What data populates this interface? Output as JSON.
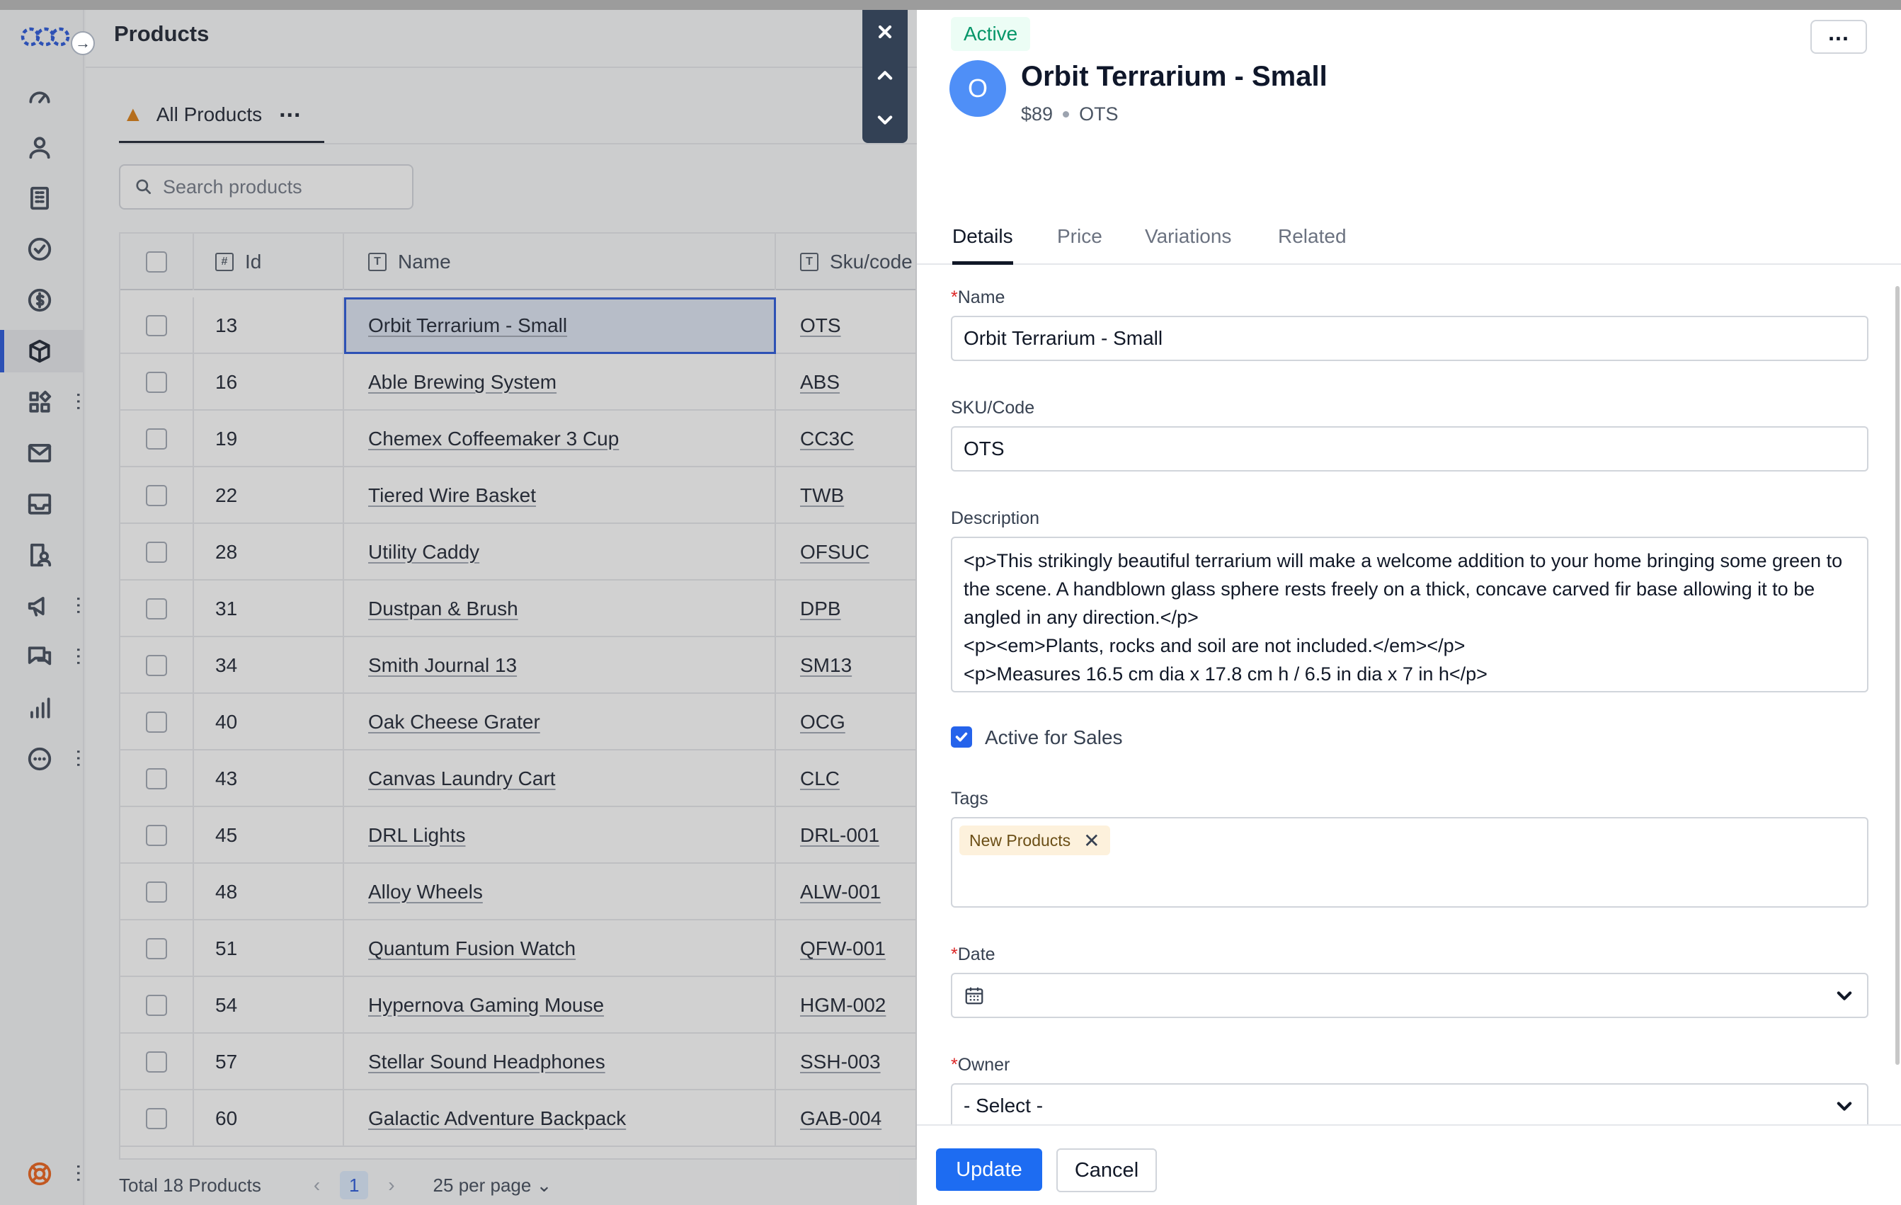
{
  "page": {
    "title": "Products"
  },
  "sidebar": {
    "items": [
      {
        "icon": "dashboard-icon"
      },
      {
        "icon": "contacts-icon"
      },
      {
        "icon": "companies-icon"
      },
      {
        "icon": "tasks-icon"
      },
      {
        "icon": "deals-icon"
      },
      {
        "icon": "products-icon",
        "active": true
      },
      {
        "icon": "apps-icon"
      },
      {
        "icon": "mail-icon"
      },
      {
        "icon": "inbox-icon"
      },
      {
        "icon": "documents-icon"
      },
      {
        "icon": "campaigns-icon"
      },
      {
        "icon": "chat-icon"
      },
      {
        "icon": "reports-icon"
      },
      {
        "icon": "more-icon"
      }
    ],
    "help_icon": "lifebuoy-icon"
  },
  "list": {
    "view_tab": "All Products",
    "search_placeholder": "Search products",
    "columns": {
      "id": "Id",
      "name": "Name",
      "sku": "Sku/code"
    },
    "rows": [
      {
        "id": "13",
        "name": "Orbit Terrarium - Small",
        "sku": "OTS"
      },
      {
        "id": "16",
        "name": "Able Brewing System",
        "sku": "ABS"
      },
      {
        "id": "19",
        "name": "Chemex Coffeemaker 3 Cup",
        "sku": "CC3C"
      },
      {
        "id": "22",
        "name": "Tiered Wire Basket",
        "sku": "TWB"
      },
      {
        "id": "28",
        "name": "Utility Caddy",
        "sku": "OFSUC"
      },
      {
        "id": "31",
        "name": "Dustpan & Brush",
        "sku": "DPB"
      },
      {
        "id": "34",
        "name": "Smith Journal 13",
        "sku": "SM13"
      },
      {
        "id": "40",
        "name": "Oak Cheese Grater",
        "sku": "OCG"
      },
      {
        "id": "43",
        "name": "Canvas Laundry Cart",
        "sku": "CLC"
      },
      {
        "id": "45",
        "name": "DRL Lights",
        "sku": "DRL-001"
      },
      {
        "id": "48",
        "name": "Alloy Wheels",
        "sku": "ALW-001"
      },
      {
        "id": "51",
        "name": "Quantum Fusion Watch",
        "sku": "QFW-001"
      },
      {
        "id": "54",
        "name": "Hypernova Gaming Mouse",
        "sku": "HGM-002"
      },
      {
        "id": "57",
        "name": "Stellar Sound Headphones",
        "sku": "SSH-003"
      },
      {
        "id": "60",
        "name": "Galactic Adventure Backpack",
        "sku": "GAB-004"
      }
    ],
    "pager": {
      "total": "Total 18 Products",
      "page": "1",
      "per_page": "25 per page"
    }
  },
  "detail": {
    "status": "Active",
    "avatar": "O",
    "title": "Orbit Terrarium - Small",
    "price": "$89",
    "sku": "OTS",
    "tabs": [
      "Details",
      "Price",
      "Variations",
      "Related"
    ],
    "fields": {
      "name_label": "Name",
      "name_value": "Orbit Terrarium - Small",
      "sku_label": "SKU/Code",
      "sku_value": "OTS",
      "description_label": "Description",
      "description_value": "<p>This strikingly beautiful terrarium will make a welcome addition to your home bringing some green to the scene. A handblown glass sphere rests freely on a thick, concave carved fir base allowing it to be angled in any direction.</p>\n<p><em>Plants, rocks and soil are not included.</em></p>\n<p>Measures 16.5 cm dia x 17.8 cm h / 6.5 in dia x 7 in h</p>",
      "active_label": "Active for Sales",
      "active_checked": true,
      "tags_label": "Tags",
      "tag": "New Products",
      "date_label": "Date",
      "owner_label": "Owner",
      "owner_value": "- Select -"
    },
    "buttons": {
      "update": "Update",
      "cancel": "Cancel"
    }
  }
}
